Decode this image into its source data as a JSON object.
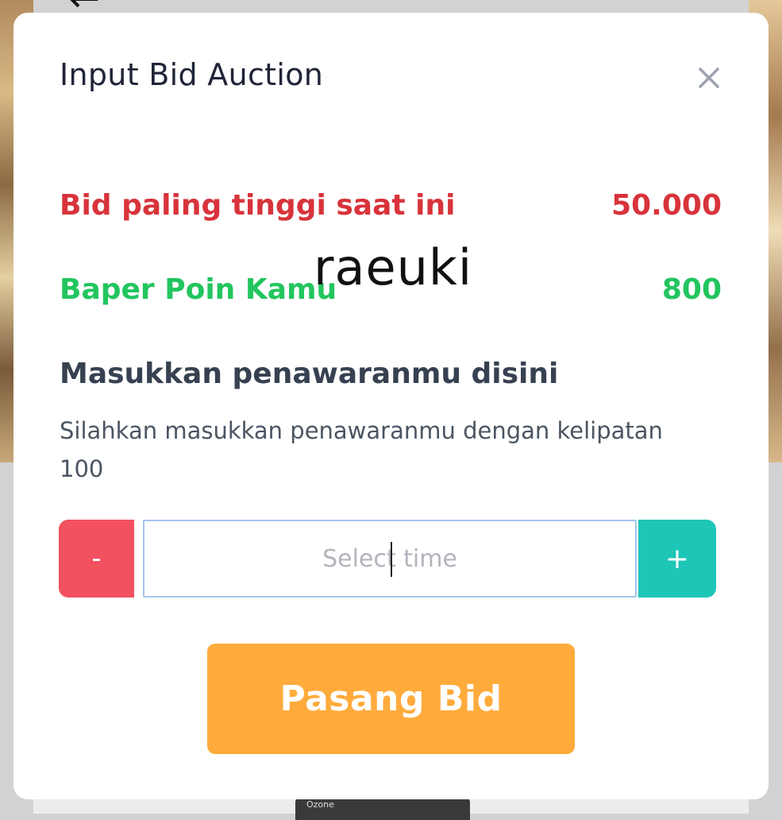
{
  "modal": {
    "title": "Input Bid Auction",
    "close_icon": "close-icon"
  },
  "highest_bid": {
    "label": "Bid paling tinggi saat ini",
    "value": "50.000",
    "color": "#d8333b"
  },
  "points": {
    "label": "Baper Poin Kamu",
    "value": "800",
    "color": "#22c55e"
  },
  "watermark": "raeuki",
  "offer": {
    "title": "Masukkan penawaranmu disini",
    "description": "Silahkan masukkan penawaranmu dengan kelipatan 100"
  },
  "stepper": {
    "minus_label": "-",
    "plus_label": "+",
    "input_value": "",
    "input_placeholder": "Select time",
    "minus_color": "#f2515f",
    "plus_color": "#1ec6b8"
  },
  "submit": {
    "label": "Pasang Bid",
    "color": "#ffab3c"
  },
  "background": {
    "product_label": "Ozone"
  }
}
